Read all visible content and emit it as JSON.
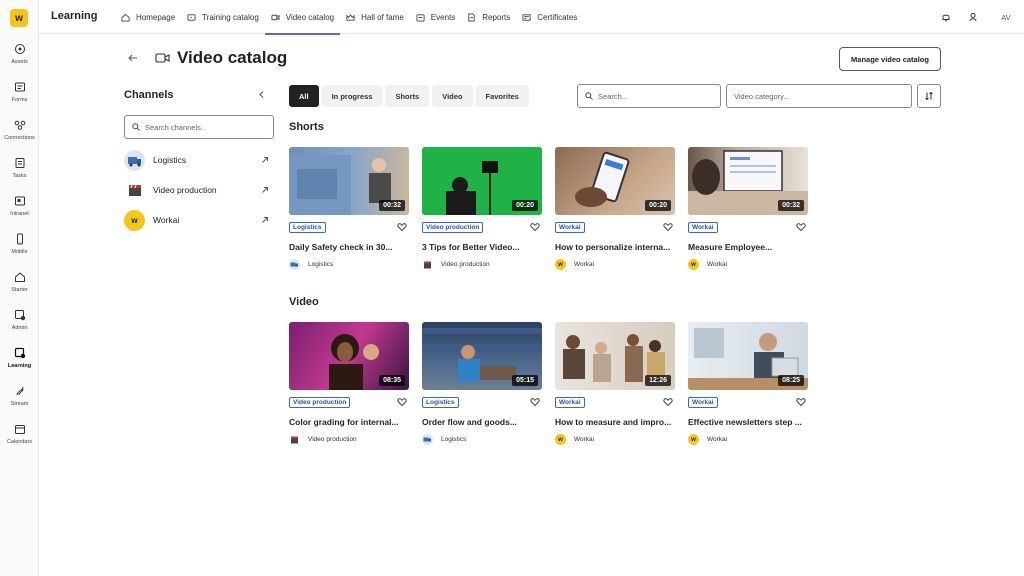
{
  "rail": {
    "logo_letter": "w",
    "items": [
      {
        "label": "Assets",
        "icon": "assets-icon"
      },
      {
        "label": "Forms",
        "icon": "forms-icon"
      },
      {
        "label": "Connections",
        "icon": "connections-icon"
      },
      {
        "label": "Tasks",
        "icon": "tasks-icon"
      },
      {
        "label": "Intranet",
        "icon": "intranet-icon"
      },
      {
        "label": "Mobile",
        "icon": "mobile-icon"
      },
      {
        "label": "Starter",
        "icon": "home-icon"
      },
      {
        "label": "Admin",
        "icon": "admin-icon"
      },
      {
        "label": "Learning",
        "icon": "learning-icon"
      },
      {
        "label": "Stream",
        "icon": "stream-icon"
      },
      {
        "label": "Calendars",
        "icon": "calendar-icon"
      }
    ]
  },
  "topbar": {
    "app_title": "Learning",
    "nav": [
      {
        "label": "Homepage",
        "icon": "home-icon"
      },
      {
        "label": "Training catalog",
        "icon": "catalog-icon"
      },
      {
        "label": "Video catalog",
        "icon": "video-icon"
      },
      {
        "label": "Hall of fame",
        "icon": "crown-icon"
      },
      {
        "label": "Events",
        "icon": "events-icon"
      },
      {
        "label": "Reports",
        "icon": "reports-icon"
      },
      {
        "label": "Certificates",
        "icon": "certificate-icon"
      }
    ],
    "avatar_initials": "AV"
  },
  "header": {
    "title": "Video catalog",
    "manage_label": "Manage video catalog"
  },
  "channels": {
    "title": "Channels",
    "search_placeholder": "Search channels..",
    "items": [
      {
        "name": "Logistics"
      },
      {
        "name": "Video production"
      },
      {
        "name": "Workai"
      }
    ]
  },
  "filters": {
    "chips": [
      "All",
      "In progress",
      "Shorts",
      "Video",
      "Favorites"
    ],
    "search_placeholder": "Search...",
    "category_placeholder": "Video category..."
  },
  "sections": {
    "shorts_title": "Shorts",
    "video_title": "Video"
  },
  "shorts": [
    {
      "tag": "Logistics",
      "duration": "00:32",
      "title": "Daily Safety check in 30...",
      "channel": "Logistics"
    },
    {
      "tag": "Video production",
      "duration": "00:20",
      "title": "3 Tips for Better Video...",
      "channel": "Video production"
    },
    {
      "tag": "Workai",
      "duration": "00:20",
      "title": "How to personalize interna...",
      "channel": "Workai"
    },
    {
      "tag": "Workai",
      "duration": "00:32",
      "title": "Measure Employee...",
      "channel": "Workai"
    }
  ],
  "videos": [
    {
      "tag": "Video production",
      "duration": "08:35",
      "title": "Color grading for internal...",
      "channel": "Video production"
    },
    {
      "tag": "Logistics",
      "duration": "05:15",
      "title": "Order flow and goods...",
      "channel": "Logistics"
    },
    {
      "tag": "Workai",
      "duration": "12:26",
      "title": "How to measure and impro...",
      "channel": "Workai"
    },
    {
      "tag": "Workai",
      "duration": "08:25",
      "title": "Effective newsletters step ...",
      "channel": "Workai"
    }
  ],
  "colors": {
    "accent": "#5b6ad0",
    "brand_yellow": "#f5c518",
    "tag_blue": "#2a4fb0"
  }
}
